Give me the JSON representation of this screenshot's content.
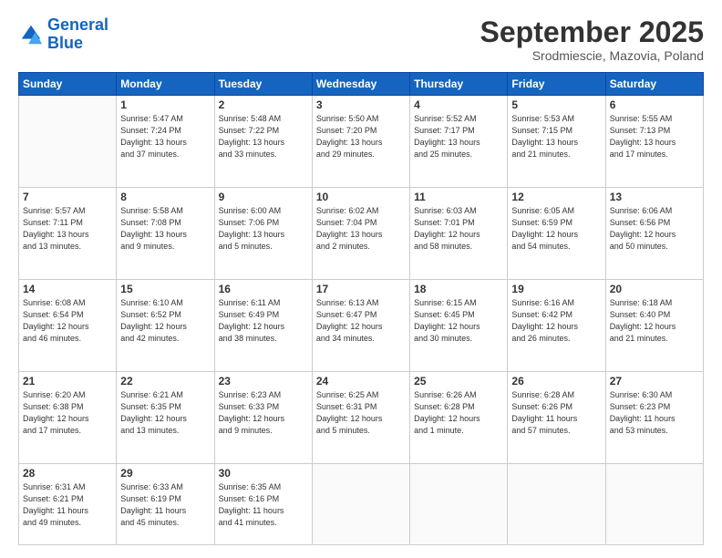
{
  "logo": {
    "line1": "General",
    "line2": "Blue"
  },
  "title": "September 2025",
  "subtitle": "Srodmiescie, Mazovia, Poland",
  "days_header": [
    "Sunday",
    "Monday",
    "Tuesday",
    "Wednesday",
    "Thursday",
    "Friday",
    "Saturday"
  ],
  "weeks": [
    [
      {
        "day": "",
        "info": ""
      },
      {
        "day": "1",
        "info": "Sunrise: 5:47 AM\nSunset: 7:24 PM\nDaylight: 13 hours\nand 37 minutes."
      },
      {
        "day": "2",
        "info": "Sunrise: 5:48 AM\nSunset: 7:22 PM\nDaylight: 13 hours\nand 33 minutes."
      },
      {
        "day": "3",
        "info": "Sunrise: 5:50 AM\nSunset: 7:20 PM\nDaylight: 13 hours\nand 29 minutes."
      },
      {
        "day": "4",
        "info": "Sunrise: 5:52 AM\nSunset: 7:17 PM\nDaylight: 13 hours\nand 25 minutes."
      },
      {
        "day": "5",
        "info": "Sunrise: 5:53 AM\nSunset: 7:15 PM\nDaylight: 13 hours\nand 21 minutes."
      },
      {
        "day": "6",
        "info": "Sunrise: 5:55 AM\nSunset: 7:13 PM\nDaylight: 13 hours\nand 17 minutes."
      }
    ],
    [
      {
        "day": "7",
        "info": "Sunrise: 5:57 AM\nSunset: 7:11 PM\nDaylight: 13 hours\nand 13 minutes."
      },
      {
        "day": "8",
        "info": "Sunrise: 5:58 AM\nSunset: 7:08 PM\nDaylight: 13 hours\nand 9 minutes."
      },
      {
        "day": "9",
        "info": "Sunrise: 6:00 AM\nSunset: 7:06 PM\nDaylight: 13 hours\nand 5 minutes."
      },
      {
        "day": "10",
        "info": "Sunrise: 6:02 AM\nSunset: 7:04 PM\nDaylight: 13 hours\nand 2 minutes."
      },
      {
        "day": "11",
        "info": "Sunrise: 6:03 AM\nSunset: 7:01 PM\nDaylight: 12 hours\nand 58 minutes."
      },
      {
        "day": "12",
        "info": "Sunrise: 6:05 AM\nSunset: 6:59 PM\nDaylight: 12 hours\nand 54 minutes."
      },
      {
        "day": "13",
        "info": "Sunrise: 6:06 AM\nSunset: 6:56 PM\nDaylight: 12 hours\nand 50 minutes."
      }
    ],
    [
      {
        "day": "14",
        "info": "Sunrise: 6:08 AM\nSunset: 6:54 PM\nDaylight: 12 hours\nand 46 minutes."
      },
      {
        "day": "15",
        "info": "Sunrise: 6:10 AM\nSunset: 6:52 PM\nDaylight: 12 hours\nand 42 minutes."
      },
      {
        "day": "16",
        "info": "Sunrise: 6:11 AM\nSunset: 6:49 PM\nDaylight: 12 hours\nand 38 minutes."
      },
      {
        "day": "17",
        "info": "Sunrise: 6:13 AM\nSunset: 6:47 PM\nDaylight: 12 hours\nand 34 minutes."
      },
      {
        "day": "18",
        "info": "Sunrise: 6:15 AM\nSunset: 6:45 PM\nDaylight: 12 hours\nand 30 minutes."
      },
      {
        "day": "19",
        "info": "Sunrise: 6:16 AM\nSunset: 6:42 PM\nDaylight: 12 hours\nand 26 minutes."
      },
      {
        "day": "20",
        "info": "Sunrise: 6:18 AM\nSunset: 6:40 PM\nDaylight: 12 hours\nand 21 minutes."
      }
    ],
    [
      {
        "day": "21",
        "info": "Sunrise: 6:20 AM\nSunset: 6:38 PM\nDaylight: 12 hours\nand 17 minutes."
      },
      {
        "day": "22",
        "info": "Sunrise: 6:21 AM\nSunset: 6:35 PM\nDaylight: 12 hours\nand 13 minutes."
      },
      {
        "day": "23",
        "info": "Sunrise: 6:23 AM\nSunset: 6:33 PM\nDaylight: 12 hours\nand 9 minutes."
      },
      {
        "day": "24",
        "info": "Sunrise: 6:25 AM\nSunset: 6:31 PM\nDaylight: 12 hours\nand 5 minutes."
      },
      {
        "day": "25",
        "info": "Sunrise: 6:26 AM\nSunset: 6:28 PM\nDaylight: 12 hours\nand 1 minute."
      },
      {
        "day": "26",
        "info": "Sunrise: 6:28 AM\nSunset: 6:26 PM\nDaylight: 11 hours\nand 57 minutes."
      },
      {
        "day": "27",
        "info": "Sunrise: 6:30 AM\nSunset: 6:23 PM\nDaylight: 11 hours\nand 53 minutes."
      }
    ],
    [
      {
        "day": "28",
        "info": "Sunrise: 6:31 AM\nSunset: 6:21 PM\nDaylight: 11 hours\nand 49 minutes."
      },
      {
        "day": "29",
        "info": "Sunrise: 6:33 AM\nSunset: 6:19 PM\nDaylight: 11 hours\nand 45 minutes."
      },
      {
        "day": "30",
        "info": "Sunrise: 6:35 AM\nSunset: 6:16 PM\nDaylight: 11 hours\nand 41 minutes."
      },
      {
        "day": "",
        "info": ""
      },
      {
        "day": "",
        "info": ""
      },
      {
        "day": "",
        "info": ""
      },
      {
        "day": "",
        "info": ""
      }
    ]
  ]
}
